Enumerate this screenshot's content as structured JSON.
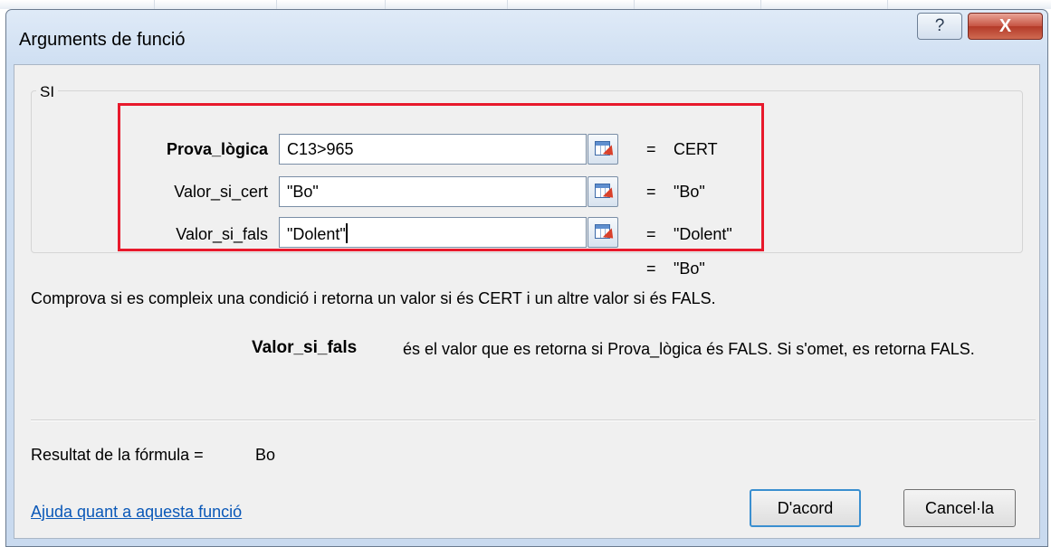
{
  "window": {
    "title": "Arguments de funció",
    "help_button": "?",
    "close_button": "X"
  },
  "function_group": {
    "name": "SI",
    "arguments": [
      {
        "label": "Prova_lògica",
        "value": "C13>965",
        "result": "CERT",
        "bold": true
      },
      {
        "label": "Valor_si_cert",
        "value": "\"Bo\"",
        "result": "\"Bo\"",
        "bold": false
      },
      {
        "label": "Valor_si_fals",
        "value": "\"Dolent\"",
        "result": "\"Dolent\"",
        "bold": false
      }
    ],
    "equals": "="
  },
  "overall_result": "\"Bo\"",
  "description": "Comprova si es compleix una condició i retorna un valor si és CERT i un altre valor si és FALS.",
  "argument_help": {
    "name": "Valor_si_fals",
    "text": "és el valor que es retorna si Prova_lògica és FALS. Si s'omet, es retorna FALS."
  },
  "formula_result": {
    "label": "Resultat de la fórmula =",
    "value": "Bo"
  },
  "footer": {
    "help_link": "Ajuda quant a aquesta funció",
    "ok_label": "D'acord",
    "cancel_label": "Cancel·la"
  },
  "colors": {
    "highlight_border": "#e8192c",
    "link": "#0a58b8",
    "default_button_border": "#3a8fd0"
  }
}
